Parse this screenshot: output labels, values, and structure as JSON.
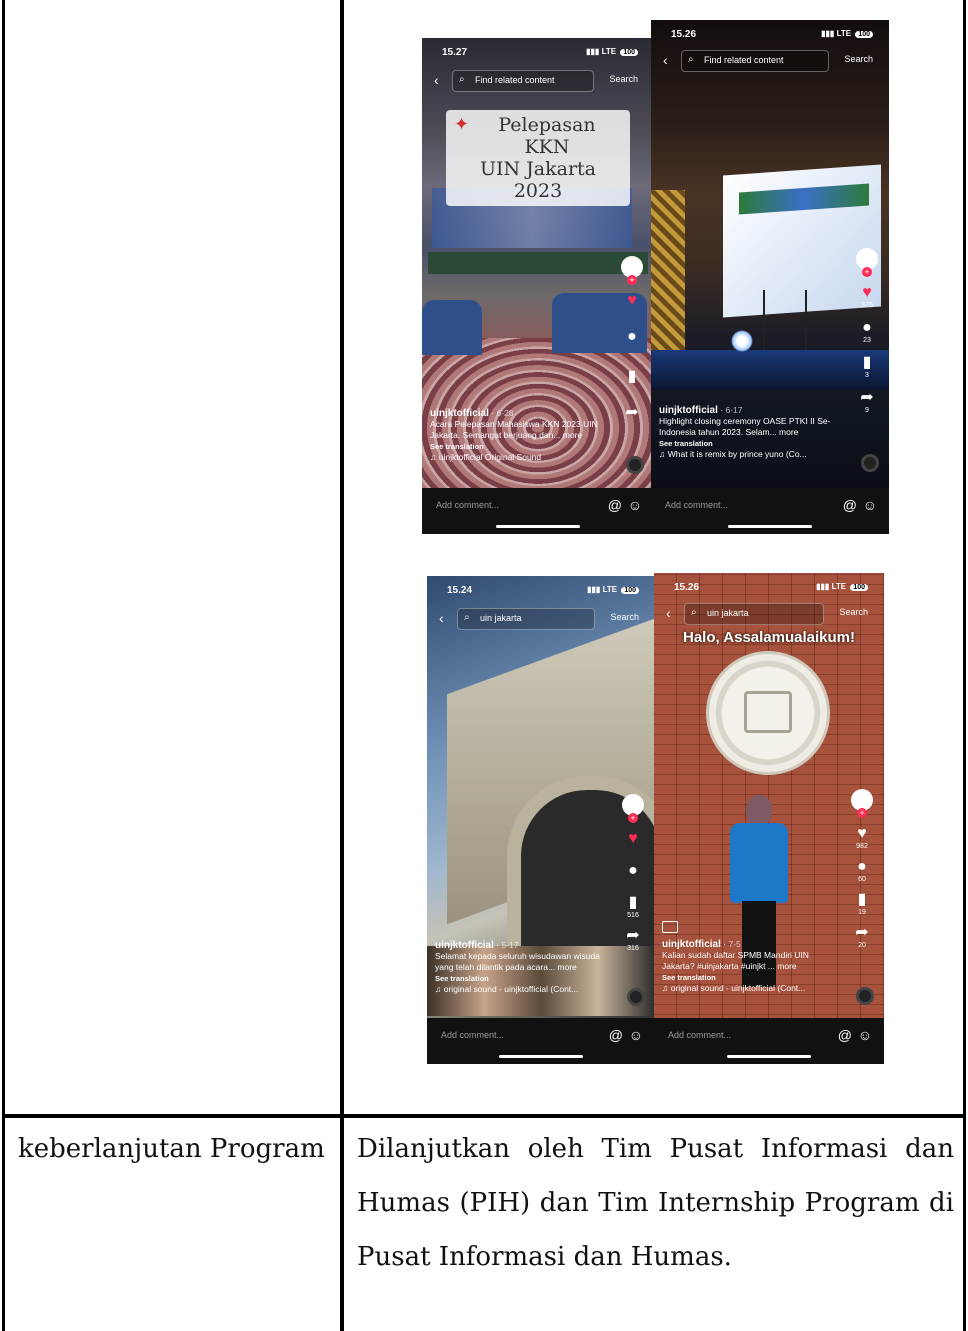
{
  "table": {
    "label_cell": "keberlanjutan Program",
    "value_lines": [
      "Dilanjutkan oleh Tim Pusat Informasi dan",
      "Humas (PIH) dan Tim Internship Program di",
      "Pusat Informasi dan Humas."
    ]
  },
  "phones": {
    "p1": {
      "time": "15.27",
      "signal": "LTE",
      "battery": "100",
      "search_query": "Find related content",
      "search_button": "Search",
      "overlay_title_line1": "Pelepasan KKN",
      "overlay_title_line2": "UIN Jakarta 2023",
      "username": "uinjktofficial",
      "date": "6-28",
      "caption": "Acara Pelepasan Mahasiswa KKN 2023 UIN Jakarta. Semangat berjuang dan... more",
      "see_translation": "See translation",
      "sound": "uinjktofficial Original Sound",
      "comment_placeholder": "Add comment..."
    },
    "p2": {
      "time": "15.26",
      "signal": "LTE",
      "battery": "100",
      "search_query": "Find related content",
      "search_button": "Search",
      "likes": "375",
      "comments": "23",
      "saves": "3",
      "shares": "9",
      "username": "uinjktofficial",
      "date": "6-17",
      "caption": "Highlight closing ceremony OASE PTKI II Se-Indonesia tahun 2023. Selam... more",
      "see_translation": "See translation",
      "sound": "What it is remix by prince yuno (Co...",
      "comment_placeholder": "Add comment..."
    },
    "p3": {
      "time": "15.24",
      "signal": "LTE",
      "battery": "100",
      "search_query": "uin jakarta",
      "search_button": "Search",
      "saves": "516",
      "shares": "316",
      "username": "uinjktofficial",
      "date": "5-17",
      "caption": "Selamat kepada seluruh wisudawan wisuda yang telah dilantik pada acara... more",
      "see_translation": "See translation",
      "sound": "original sound - uinjktofficial (Cont...",
      "comment_placeholder": "Add comment..."
    },
    "p4": {
      "time": "15.26",
      "signal": "LTE",
      "battery": "100",
      "search_query": "uin jakarta",
      "search_button": "Search",
      "greeting": "Halo, Assalamualaikum!",
      "likes": "982",
      "comments": "60",
      "saves": "19",
      "shares": "20",
      "username": "uinjktofficial",
      "date": "7-5",
      "caption": "Kalian sudah daftar SPMB Mandiri UIN Jakarta? #uinjakarta #uinjkt ... more",
      "see_translation": "See translation",
      "sound": "original sound - uinjktofficial (Cont...",
      "comment_placeholder": "Add comment..."
    }
  },
  "colors": {
    "like_red": "#fe2c55",
    "table_border": "#000000"
  }
}
